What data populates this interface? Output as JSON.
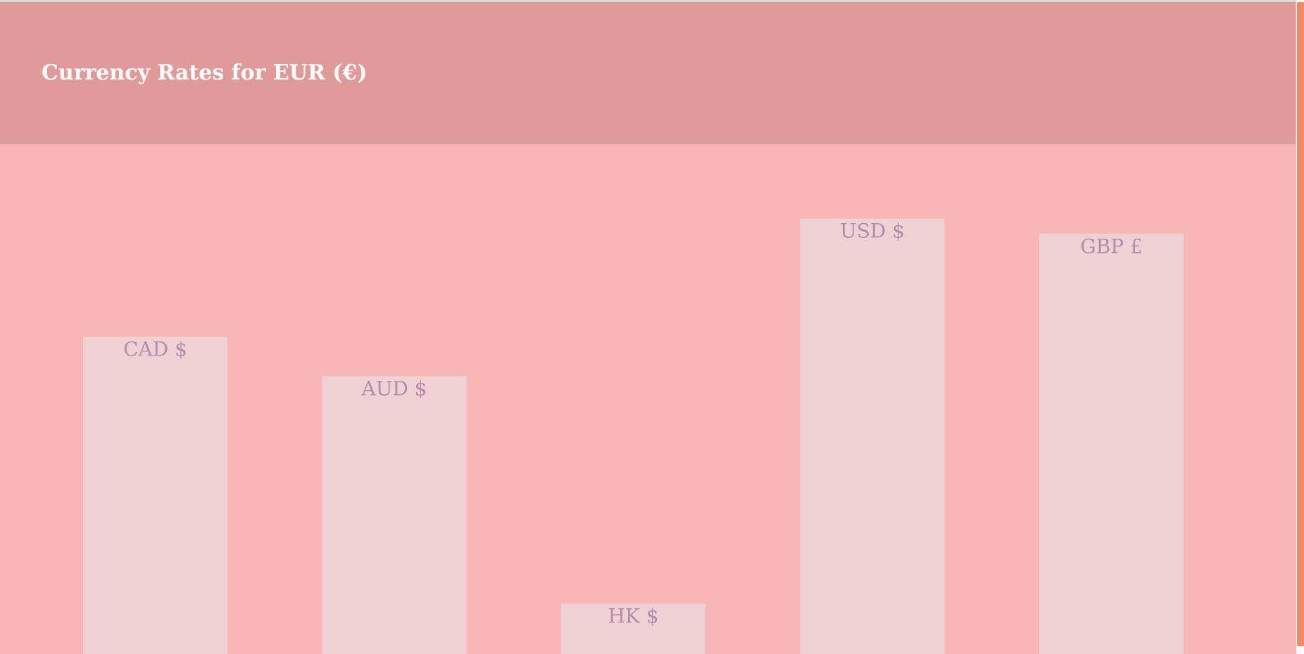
{
  "header": {
    "title": "Currency Rates for EUR (€)"
  },
  "colors": {
    "header_bg": "#e19a9a",
    "chart_bg": "#f9b6b7",
    "bar_fill": "#f0d1d3",
    "label_color": "#b48aad",
    "scrollbar_thumb": "#ef8a64"
  },
  "chart_data": {
    "type": "bar",
    "title": "Currency Rates for EUR (€)",
    "categories": [
      "CAD $",
      "AUD $",
      "HK $",
      "USD $",
      "GBP £"
    ],
    "values": [
      1.45,
      1.27,
      0.23,
      1.99,
      1.92
    ],
    "xlabel": "",
    "ylabel": "",
    "ylim": [
      0,
      2.33
    ],
    "grid": false,
    "legend": "none"
  }
}
